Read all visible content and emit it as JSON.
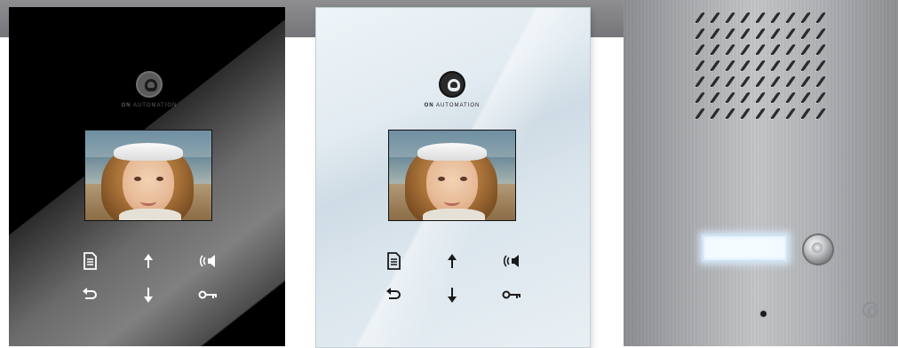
{
  "brand": {
    "name_bold": "ON",
    "name_rest": " AUTOMATION"
  },
  "products": [
    {
      "finish": "black glass",
      "type": "video monitor"
    },
    {
      "finish": "white glass",
      "type": "video monitor"
    },
    {
      "finish": "stainless steel",
      "type": "door station"
    }
  ],
  "icons": [
    "document-icon",
    "arrow-up-icon",
    "speaker-icon",
    "back-arrow-icon",
    "arrow-down-icon",
    "key-icon"
  ],
  "colors": {
    "top_bar": "#808084",
    "black_panel": "#000000",
    "white_panel": "#e2ebf1",
    "steel_panel": "#b0b2b5"
  }
}
